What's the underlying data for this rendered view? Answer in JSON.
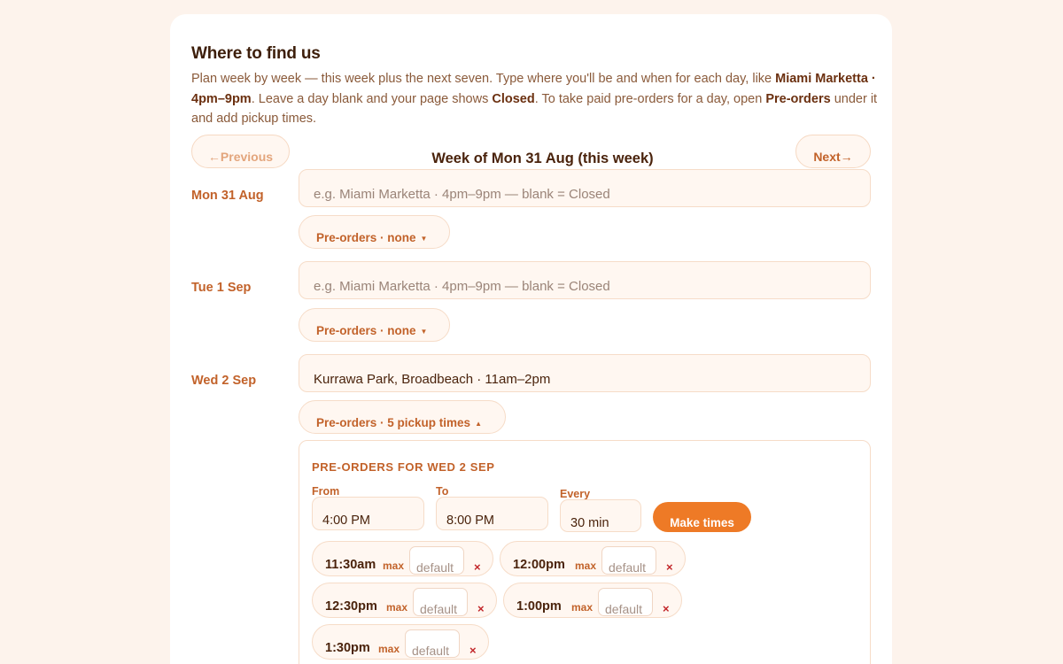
{
  "header": {
    "title": "Where to find us",
    "intro": {
      "part1": "Plan week by week — this week plus the next seven. Type where you'll be and when for each day, like ",
      "example_bold": "Miami Marketta · 4pm–9pm",
      "part2": ". Leave a day blank and your page shows ",
      "closed_bold": "Closed",
      "part3": ". To take paid pre-orders for a day, open ",
      "preorders_bold": "Pre-orders",
      "part4": " under it and add pickup times."
    }
  },
  "week_nav": {
    "prev_label": "←Previous",
    "next_label": "Next→",
    "week_label": "Week of Mon 31 Aug (this week)"
  },
  "days": [
    {
      "label": "Mon 31 Aug",
      "value": "",
      "placeholder": "e.g. Miami Marketta · 4pm–9pm — blank = Closed",
      "preorders_label": "Pre-orders · none",
      "arrow": "▼"
    },
    {
      "label": "Tue 1 Sep",
      "value": "",
      "placeholder": "e.g. Miami Marketta · 4pm–9pm — blank = Closed",
      "preorders_label": "Pre-orders · none",
      "arrow": "▼"
    },
    {
      "label": "Wed 2 Sep",
      "value": "Kurrawa Park, Broadbeach · 11am–2pm",
      "placeholder": "",
      "preorders_label": "Pre-orders · 5 pickup times",
      "arrow": "▲"
    }
  ],
  "preorders_panel": {
    "title": "PRE-ORDERS FOR WED 2 SEP",
    "from_label": "From",
    "from_value": "4:00 PM",
    "to_label": "To",
    "to_value": "8:00 PM",
    "every_label": "Every",
    "every_value": "30 min",
    "make_button": "Make times",
    "slots": [
      {
        "time": "11:30am",
        "max_label": "max",
        "placeholder": "default"
      },
      {
        "time": "12:00pm",
        "max_label": "max",
        "placeholder": "default"
      },
      {
        "time": "12:30pm",
        "max_label": "max",
        "placeholder": "default"
      },
      {
        "time": "1:00pm",
        "max_label": "max",
        "placeholder": "default"
      },
      {
        "time": "1:30pm",
        "max_label": "max",
        "placeholder": "default"
      }
    ],
    "remove_symbol": "×"
  },
  "colors": {
    "accent": "#ee7a26",
    "label": "#c2622a",
    "remove": "#c2262a",
    "background": "#fdf3ec"
  }
}
